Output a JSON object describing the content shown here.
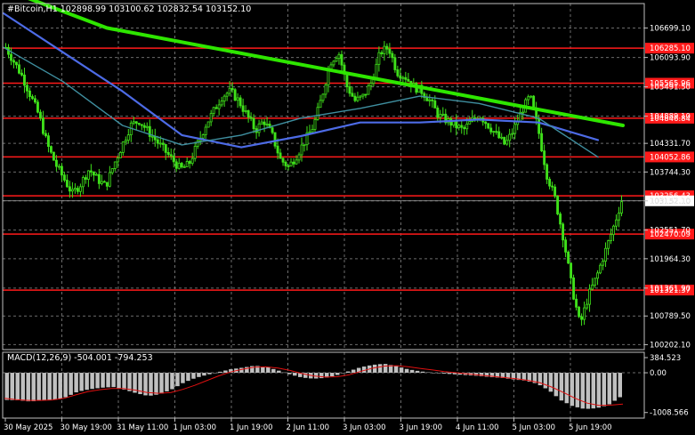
{
  "chart_data": [
    {
      "type": "candlestick",
      "title": "#Bitcoin,H1  102898.99 103100.62 102832.54 103152.10",
      "current_price": 103152.1,
      "y_ticks": [
        "106699.10",
        "106093.90",
        "105491.50",
        "104889.10",
        "104331.70",
        "103744.30",
        "103152.10",
        "102551.70",
        "101964.30",
        "101361.90",
        "100789.50",
        "100202.10"
      ],
      "ylim": [
        100100,
        107200
      ],
      "x_ticks": [
        "30 May 2025",
        "30 May 19:00",
        "31 May 11:00",
        "1 Jun 03:00",
        "1 Jun 19:00",
        "2 Jun 11:00",
        "3 Jun 03:00",
        "3 Jun 19:00",
        "4 Jun 11:00",
        "5 Jun 03:00",
        "5 Jun 19:00"
      ],
      "levels": [
        {
          "value": 106285.1,
          "label": "106285.10"
        },
        {
          "value": 105565.96,
          "label": "105565.96"
        },
        {
          "value": 104846.84,
          "label": "104846.84"
        },
        {
          "value": 104052.86,
          "label": "104052.86"
        },
        {
          "value": 103256.43,
          "label": "103256.43"
        },
        {
          "value": 102470.09,
          "label": "102470.09"
        },
        {
          "value": 101321.37,
          "label": "101321.37"
        }
      ],
      "price_path": [
        106300,
        106000,
        105700,
        105300,
        104900,
        104300,
        103900,
        103600,
        103300,
        103500,
        103800,
        103600,
        103450,
        103900,
        104300,
        104700,
        104800,
        104600,
        104400,
        104200,
        104000,
        103800,
        103900,
        104300,
        104700,
        105000,
        105300,
        105400,
        105200,
        104900,
        104600,
        104800,
        104500,
        104000,
        103850,
        104100,
        104400,
        104700,
        105300,
        106000,
        106200,
        105500,
        105200,
        105300,
        105600,
        106200,
        106300,
        105800,
        105700,
        105500,
        105400,
        105200,
        104900,
        104800,
        104700,
        104600,
        104800,
        104900,
        104700,
        104500,
        104300,
        104600,
        105000,
        105300,
        104600,
        103700,
        103200,
        102400,
        101400,
        100600,
        101200,
        101600,
        102100,
        102600,
        103152.1
      ],
      "series": [
        {
          "name": "",
          "color": "#2ee600",
          "values": [
            107500,
            106700,
            106300,
            105900,
            105500,
            105100,
            104700
          ]
        },
        {
          "name": "",
          "color": "#4d6be6",
          "values": [
            107000,
            106200,
            105400,
            104500,
            104250,
            104480,
            104760,
            104760,
            104820,
            104760,
            104400
          ]
        },
        {
          "name": "",
          "color": "#3f8fa0",
          "values": [
            106300,
            105600,
            104700,
            104300,
            104500,
            104850,
            105050,
            105300,
            105150,
            104850,
            104050
          ]
        }
      ]
    },
    {
      "type": "bar",
      "title": "MACD(12,26,9) -504.001 -794.253",
      "y_ticks": [
        "384.523",
        "0.00",
        "-1008.566"
      ],
      "ylim": [
        -1150,
        520
      ],
      "macd": [
        -690,
        -700,
        -730,
        -700,
        -690,
        -620,
        -480,
        -420,
        -380,
        -360,
        -430,
        -520,
        -590,
        -540,
        -420,
        -250,
        -130,
        -50,
        20,
        90,
        130,
        180,
        150,
        60,
        -40,
        -120,
        -150,
        -130,
        -60,
        40,
        140,
        200,
        230,
        170,
        90,
        40,
        0,
        -20,
        -40,
        -60,
        -80,
        -110,
        -130,
        -170,
        -200,
        -280,
        -450,
        -700,
        -850,
        -920,
        -900,
        -820,
        -620
      ],
      "signal": [
        -650,
        -680,
        -700,
        -700,
        -690,
        -650,
        -560,
        -480,
        -430,
        -400,
        -400,
        -440,
        -500,
        -520,
        -500,
        -420,
        -320,
        -200,
        -80,
        20,
        90,
        140,
        150,
        120,
        60,
        -20,
        -80,
        -110,
        -100,
        -50,
        40,
        120,
        170,
        180,
        150,
        110,
        70,
        30,
        0,
        -30,
        -60,
        -90,
        -120,
        -150,
        -190,
        -250,
        -360,
        -500,
        -650,
        -770,
        -830,
        -820,
        -794
      ]
    }
  ]
}
